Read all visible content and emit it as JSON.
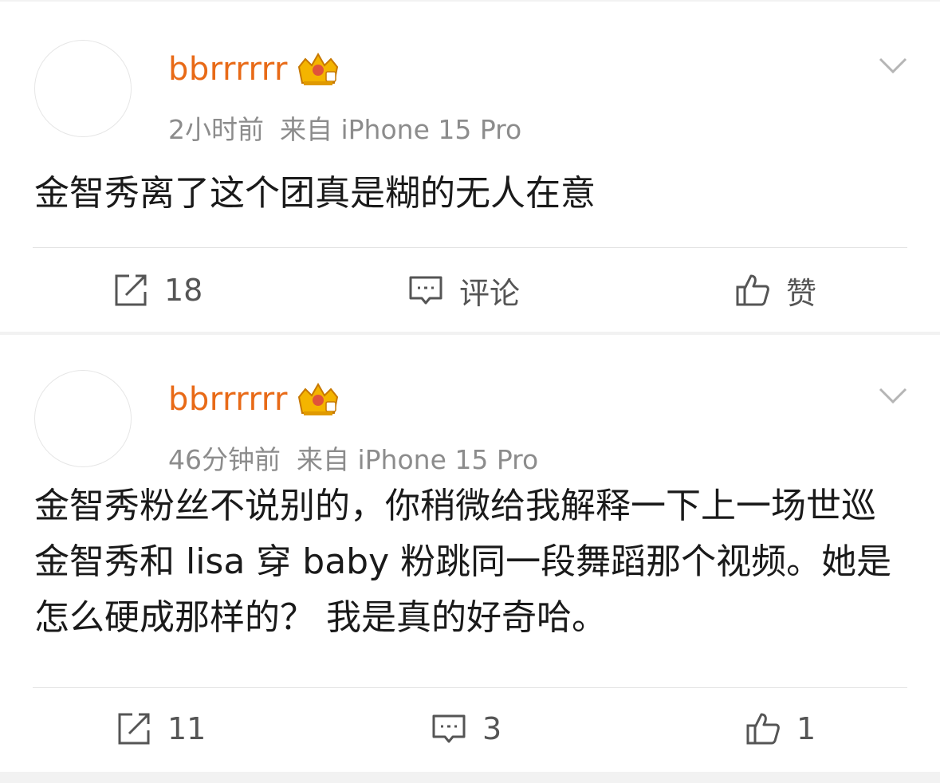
{
  "posts": [
    {
      "username": "bbrrrrrr",
      "time": "2小时前",
      "source": "来自 iPhone 15 Pro",
      "content": "金智秀离了这个团真是糊的无人在意",
      "repost_label": "18",
      "comment_label": "评论",
      "like_label": "赞"
    },
    {
      "username": "bbrrrrrr",
      "time": "46分钟前",
      "source": "来自 iPhone 15 Pro",
      "content": "金智秀粉丝不说别的，你稍微给我解释一下上一场世巡金智秀和 lisa 穿 baby 粉跳同一段舞蹈那个视频。她是怎么硬成那样的？ 我是真的好奇哈。",
      "repost_label": "11",
      "comment_label": "3",
      "like_label": "1"
    }
  ],
  "colors": {
    "username": "#e86a17",
    "meta": "#8c8c8c",
    "background": "#f2f2f2",
    "icon": "#555555"
  },
  "icons": {
    "badge": "crown-badge-icon",
    "menu": "chevron-down-icon",
    "repost": "repost-icon",
    "comment": "comment-icon",
    "like": "thumbs-up-icon"
  }
}
